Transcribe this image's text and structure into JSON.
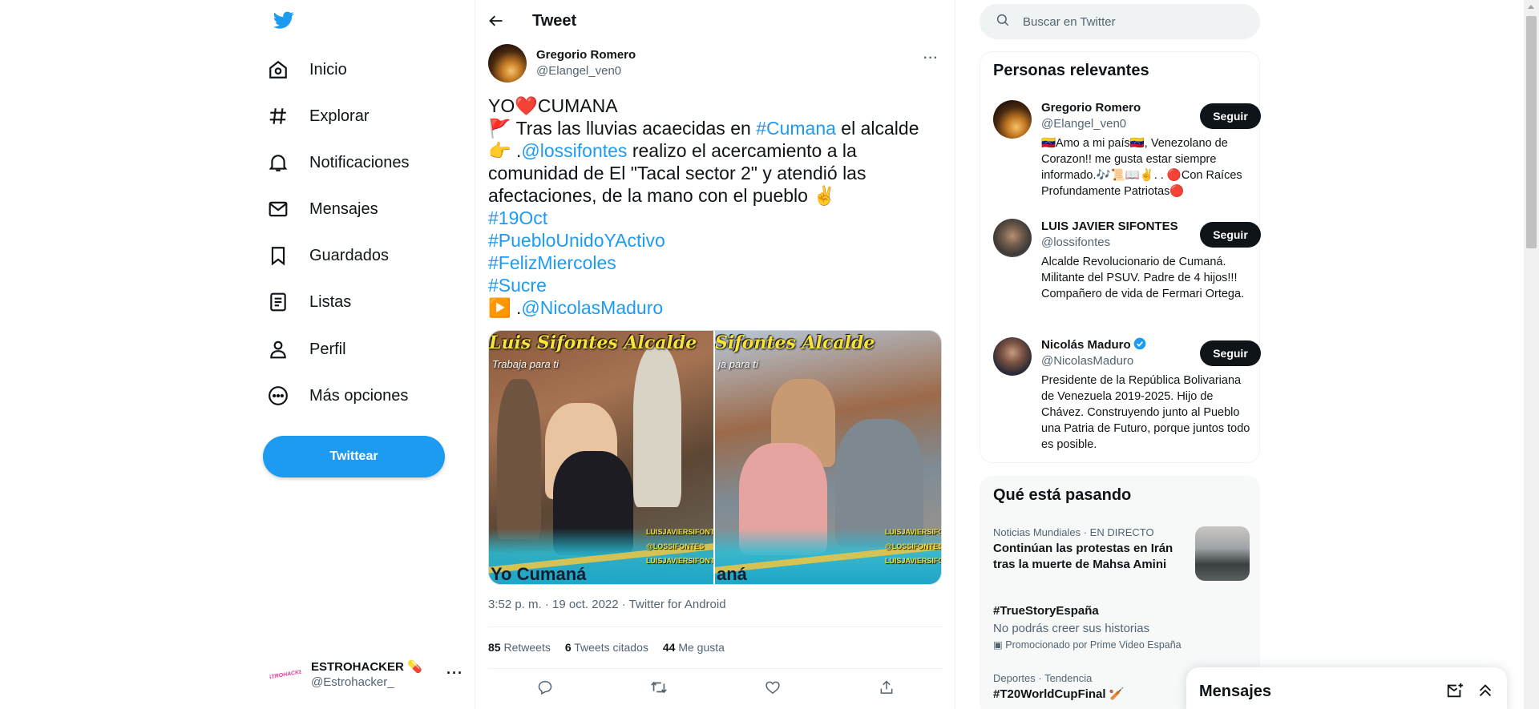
{
  "nav": {
    "items": [
      {
        "label": "Inicio",
        "icon": "home-icon"
      },
      {
        "label": "Explorar",
        "icon": "hashtag-icon"
      },
      {
        "label": "Notificaciones",
        "icon": "bell-icon"
      },
      {
        "label": "Mensajes",
        "icon": "envelope-icon"
      },
      {
        "label": "Guardados",
        "icon": "bookmark-icon"
      },
      {
        "label": "Listas",
        "icon": "list-icon"
      },
      {
        "label": "Perfil",
        "icon": "person-icon"
      },
      {
        "label": "Más opciones",
        "icon": "more-circle-icon"
      }
    ],
    "tweet_button": "Twittear",
    "account": {
      "display_name": "ESTROHACKER 💊",
      "username": "@Estrohacker_",
      "avatar_text": "ESTROHACKER",
      "more": "···"
    }
  },
  "header": {
    "title": "Tweet"
  },
  "tweet": {
    "author": {
      "display_name": "Gregorio Romero",
      "username": "@Elangel_ven0"
    },
    "text": {
      "line1": "YO❤️CUMANA",
      "l2a": "🚩 Tras las lluvias acaecidas en ",
      "l2tag": "#Cumana",
      "l2b": " el alcalde",
      "l3a": "👉 .",
      "l3tag": "@lossifontes",
      "l3b": " realizo el acercamiento a la",
      "l4": "comunidad de El \"Tacal sector 2\" y atendió las",
      "l5": "afectaciones, de la mano con el pueblo ✌️",
      "h1": "#19Oct",
      "h2": "#PuebloUnidoYActivo",
      "h3": "#FelizMiercoles",
      "h4": "#Sucre",
      "l10a": "▶️ .",
      "l10tag": "@NicolasMaduro"
    },
    "media": {
      "left_banner": "Luis Sifontes Alcalde",
      "left_sub": "Trabaja para ti",
      "right_banner": "Sifontes Alcalde",
      "right_sub": "ja para ti",
      "logo_left": "Yo Cumaná",
      "logo_right": "aná",
      "socials": [
        "LUISJAVIERSIFONTES",
        "@LOSSIFONTES",
        "LUISJAVIERSIFONTES"
      ]
    },
    "meta": "3:52 p. m. · 19 oct. 2022 · Twitter for Android",
    "stats": {
      "retweets_count": "85",
      "retweets_label": "Retweets",
      "quotes_count": "6",
      "quotes_label": "Tweets citados",
      "likes_count": "44",
      "likes_label": "Me gusta"
    }
  },
  "search": {
    "placeholder": "Buscar en Twitter"
  },
  "relevant": {
    "title": "Personas relevantes",
    "follow_label": "Seguir",
    "people": [
      {
        "name": "Gregorio Romero",
        "handle": "@Elangel_ven0",
        "bio": "🇻🇪Amo a mi país🇻🇪, Venezolano de Corazon!! me gusta estar siempre informado.🎶📜📖✌️. . 🔴Con Raíces Profundamente Patriotas🔴"
      },
      {
        "name": "LUIS JAVIER SIFONTES",
        "handle": "@lossifontes",
        "bio": "Alcalde Revolucionario de Cumaná. Militante del PSUV. Padre de 4 hijos!!! Compañero de vida de Fermari Ortega."
      },
      {
        "name": "Nicolás Maduro",
        "handle": "@NicolasMaduro",
        "bio": "Presidente de la República Bolivariana de Venezuela 2019-2025. Hijo de Chávez. Construyendo junto al Pueblo una Patria de Futuro, porque juntos todo es posible."
      }
    ]
  },
  "trends": {
    "title": "Qué está pasando",
    "items": [
      {
        "context": "Noticias Mundiales · EN DIRECTO",
        "title": "Continúan las protestas en Irán tras la muerte de Mahsa Amini"
      },
      {
        "title": "#TrueStoryEspaña",
        "desc": "No podrás creer sus historias",
        "promo": "Promocionado por Prime Video España"
      },
      {
        "context": "Deportes · Tendencia",
        "title": "#T20WorldCupFinal 🏏"
      }
    ]
  },
  "drawer": {
    "title": "Mensajes"
  },
  "colors": {
    "accent": "#1d9bf0",
    "text": "#0f1419",
    "muted": "#536471"
  }
}
